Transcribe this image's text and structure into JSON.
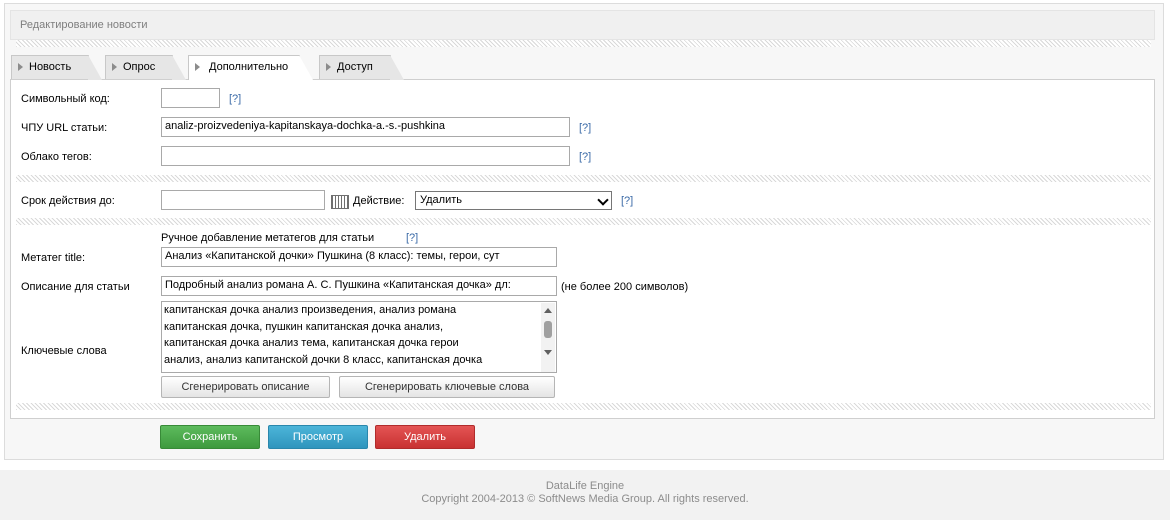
{
  "header": {
    "title": "Редактирование новости"
  },
  "tabs": [
    {
      "label": "Новость"
    },
    {
      "label": "Опрос"
    },
    {
      "label": "Дополнительно"
    },
    {
      "label": "Доступ"
    }
  ],
  "form": {
    "symbol_code": {
      "label": "Символьный код:",
      "value": "",
      "help": "[?]"
    },
    "url": {
      "label": "ЧПУ URL статьи:",
      "value": "analiz-proizvedeniya-kapitanskaya-dochka-a.-s.-pushkina",
      "help": "[?]"
    },
    "tags": {
      "label": "Облако тегов:",
      "value": "",
      "help": "[?]"
    },
    "expiry": {
      "label": "Срок действия до:",
      "value": "",
      "action_label": "Действие:",
      "action_value": "Удалить",
      "help": "[?]"
    },
    "meta_heading": "Ручное добавление метатегов для статьи",
    "meta_help": "[?]",
    "meta_title": {
      "label": "Метатег title:",
      "value": "Анализ «Капитанской дочки» Пушкина (8 класс): темы, герои, сут"
    },
    "description": {
      "label": "Описание для статьи",
      "value": "Подробный анализ романа А. С. Пушкина «Капитанская дочка» дл:",
      "note": "(не более 200 символов)"
    },
    "keywords": {
      "label": "Ключевые слова",
      "value": "капитанская дочка анализ произведения, анализ романа\nкапитанская дочка, пушкин капитанская дочка анализ,\nкапитанская дочка анализ тема, капитанская дочка герои\nанализ, анализ капитанской дочки 8 класс, капитанская дочка"
    },
    "gen_description": "Сгенерировать описание",
    "gen_keywords": "Сгенерировать ключевые слова"
  },
  "actions": {
    "save": "Сохранить",
    "preview": "Просмотр",
    "delete": "Удалить"
  },
  "footer": {
    "line1": "DataLife Engine",
    "line2": "Copyright 2004-2013 © SoftNews Media Group. All rights reserved."
  }
}
